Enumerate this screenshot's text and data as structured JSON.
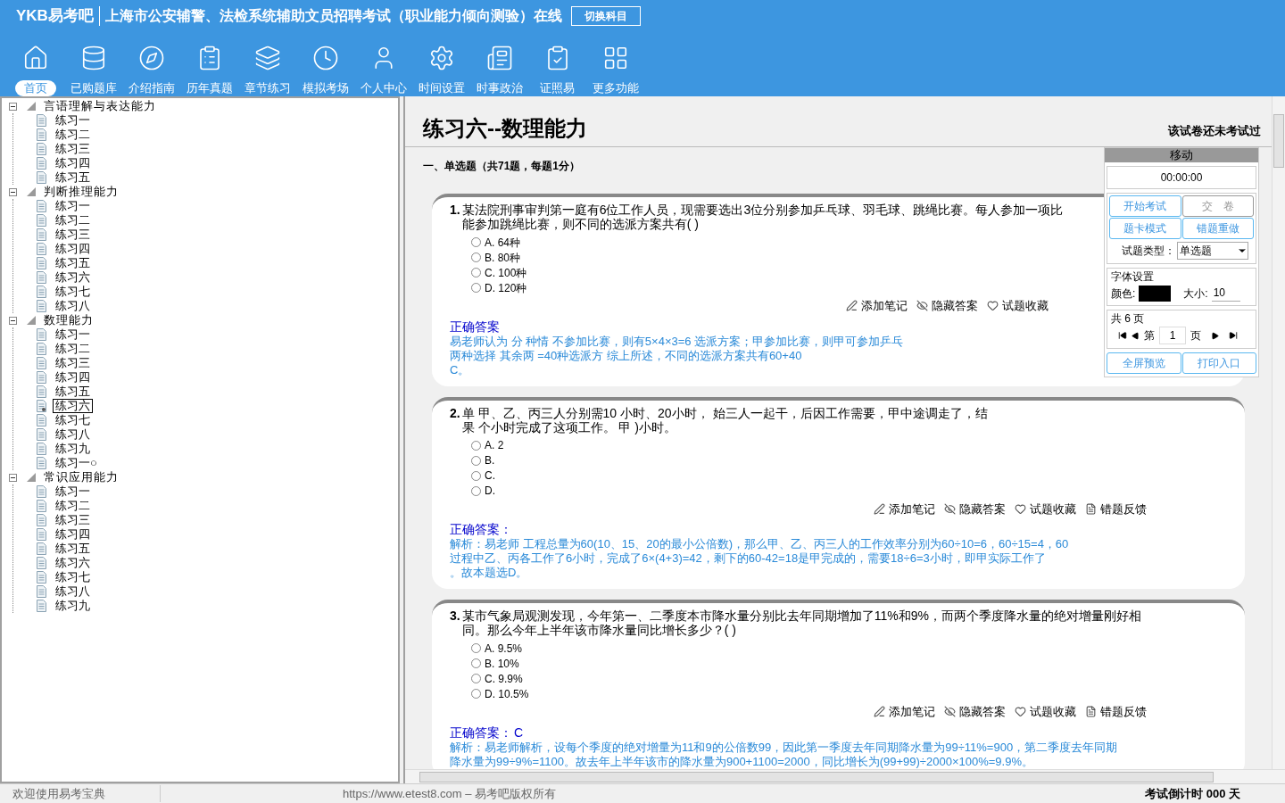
{
  "header": {
    "logo": "YKB易考吧",
    "title": "上海市公安辅警、法检系统辅助文员招聘考试（职业能力倾向测验）在线",
    "switch_button": "切换科目"
  },
  "toolbar": [
    {
      "label": "首页",
      "selected": true
    },
    {
      "label": "已购题库",
      "selected": false
    },
    {
      "label": "介绍指南",
      "selected": false
    },
    {
      "label": "历年真题",
      "selected": false
    },
    {
      "label": "章节练习",
      "selected": false
    },
    {
      "label": "模拟考场",
      "selected": false
    },
    {
      "label": "个人中心",
      "selected": false
    },
    {
      "label": "时间设置",
      "selected": false
    },
    {
      "label": "时事政治",
      "selected": false
    },
    {
      "label": "证照易",
      "selected": false
    },
    {
      "label": "更多功能",
      "selected": false
    }
  ],
  "tree": [
    {
      "label": "言语理解与表达能力",
      "expanded": true,
      "children": [
        {
          "label": "练习一",
          "selected": false
        },
        {
          "label": "练习二",
          "selected": false
        },
        {
          "label": "练习三",
          "selected": false
        },
        {
          "label": "练习四",
          "selected": false
        },
        {
          "label": "练习五",
          "selected": false
        }
      ]
    },
    {
      "label": "判断推理能力",
      "expanded": true,
      "children": [
        {
          "label": "练习一",
          "selected": false
        },
        {
          "label": "练习二",
          "selected": false
        },
        {
          "label": "练习三",
          "selected": false
        },
        {
          "label": "练习四",
          "selected": false
        },
        {
          "label": "练习五",
          "selected": false
        },
        {
          "label": "练习六",
          "selected": false
        },
        {
          "label": "练习七",
          "selected": false
        },
        {
          "label": "练习八",
          "selected": false
        }
      ]
    },
    {
      "label": "数理能力",
      "expanded": true,
      "children": [
        {
          "label": "练习一",
          "selected": false
        },
        {
          "label": "练习二",
          "selected": false
        },
        {
          "label": "练习三",
          "selected": false
        },
        {
          "label": "练习四",
          "selected": false
        },
        {
          "label": "练习五",
          "selected": false
        },
        {
          "label": "练习六",
          "selected": true
        },
        {
          "label": "练习七",
          "selected": false
        },
        {
          "label": "练习八",
          "selected": false
        },
        {
          "label": "练习九",
          "selected": false
        },
        {
          "label": "练习一○",
          "selected": false
        }
      ]
    },
    {
      "label": "常识应用能力",
      "expanded": true,
      "children": [
        {
          "label": "练习一",
          "selected": false
        },
        {
          "label": "练习二",
          "selected": false
        },
        {
          "label": "练习三",
          "selected": false
        },
        {
          "label": "练习四",
          "selected": false
        },
        {
          "label": "练习五",
          "selected": false
        },
        {
          "label": "练习六",
          "selected": false
        },
        {
          "label": "练习七",
          "selected": false
        },
        {
          "label": "练习八",
          "selected": false
        },
        {
          "label": "练习九",
          "selected": false
        }
      ]
    }
  ],
  "paper": {
    "title": "练习六--数理能力",
    "status": "该试卷还未考试过",
    "section": "一、单选题（共71题，每题1分）",
    "questions": [
      {
        "number": "1.",
        "lines": [
          "某法院刑事审判第一庭有6位工作人员，现需要选出3位分别参加乒乓球、羽毛球、跳绳比赛。每人参加一项比",
          "能参加跳绳比赛，则不同的选派方案共有( )"
        ],
        "options": [
          {
            "label": "A. 64种",
            "selected": false
          },
          {
            "label": "B. 80种",
            "selected": false
          },
          {
            "label": "C. 100种",
            "selected": false
          },
          {
            "label": "D. 120种",
            "selected": false
          }
        ],
        "actions": [
          "添加笔记",
          "隐藏答案",
          "试题收藏"
        ],
        "answer_label": "正确答案",
        "analysis": [
          "易老师认为 分 种情 不参加比赛，则有5×4×3=6 选派方案；甲参加比赛，则甲可参加乒乓",
          "两种选择 其余两 =40种选派方 综上所述，不同的选派方案共有60+40",
          "C。"
        ]
      },
      {
        "number": "2.",
        "lines": [
          "单 甲、乙、丙三人分别需10 小时、20小时， 始三人一起干，后因工作需要，甲中途调走了，结",
          "果 个小时完成了这项工作。 甲 )小时。"
        ],
        "options": [
          {
            "label": "A. 2",
            "selected": false
          },
          {
            "label": "B.",
            "selected": false
          },
          {
            "label": "C.",
            "selected": false
          },
          {
            "label": "D.",
            "selected": false
          }
        ],
        "actions": [
          "添加笔记",
          "隐藏答案",
          "试题收藏",
          "错题反馈"
        ],
        "answer_label": "正确答案：",
        "analysis": [
          "解析：易老师 工程总量为60(10、15、20的最小公倍数)，那么甲、乙、丙三人的工作效率分别为60÷10=6，60÷15=4，60",
          "过程中乙、丙各工作了6小时，完成了6×(4+3)=42，剩下的60-42=18是甲完成的，需要18÷6=3小时，即甲实际工作了",
          "。故本题选D。"
        ]
      },
      {
        "number": "3.",
        "lines": [
          "某市气象局观测发现，今年第一、二季度本市降水量分别比去年同期增加了11%和9%，而两个季度降水量的绝对增量刚好相",
          "同。那么今年上半年该市降水量同比增长多少？( )"
        ],
        "options": [
          {
            "label": "A. 9.5%",
            "selected": false
          },
          {
            "label": "B. 10%",
            "selected": false
          },
          {
            "label": "C. 9.9%",
            "selected": false
          },
          {
            "label": "D. 10.5%",
            "selected": false
          }
        ],
        "actions": [
          "添加笔记",
          "隐藏答案",
          "试题收藏",
          "错题反馈"
        ],
        "answer_label": "正确答案：",
        "answer": "C",
        "analysis": [
          "解析：易老师解析，设每个季度的绝对增量为11和9的公倍数99，因此第一季度去年同期降水量为99÷11%=900，第二季度去年同期",
          "降水量为99÷9%=1100。故去年上半年该市的降水量为900+1100=2000，同比增长为(99+99)÷2000×100%=9.9%。"
        ]
      }
    ]
  },
  "panel": {
    "header": "移动",
    "timer": "00:00:00",
    "buttons": [
      {
        "label": "开始考试",
        "disabled": false
      },
      {
        "label": "交　卷",
        "disabled": true
      },
      {
        "label": "题卡模式",
        "disabled": false
      },
      {
        "label": "错题重做",
        "disabled": false
      }
    ],
    "type_label": "试题类型：",
    "type_value": "单选题",
    "font_group": "字体设置",
    "color_label": "颜色:",
    "color": "#000000",
    "size_label": "大小:",
    "size_value": "10",
    "pages_group": "共 6 页",
    "page_prefix": "第",
    "page_value": "1",
    "page_suffix": "页",
    "bottom_buttons": [
      "全屏预览",
      "打印入口"
    ]
  },
  "status_bar": {
    "welcome": "欢迎使用易考宝典",
    "copyright": "https://www.etest8.com – 易考吧版权所有",
    "countdown": "考试倒计时 000 天"
  }
}
